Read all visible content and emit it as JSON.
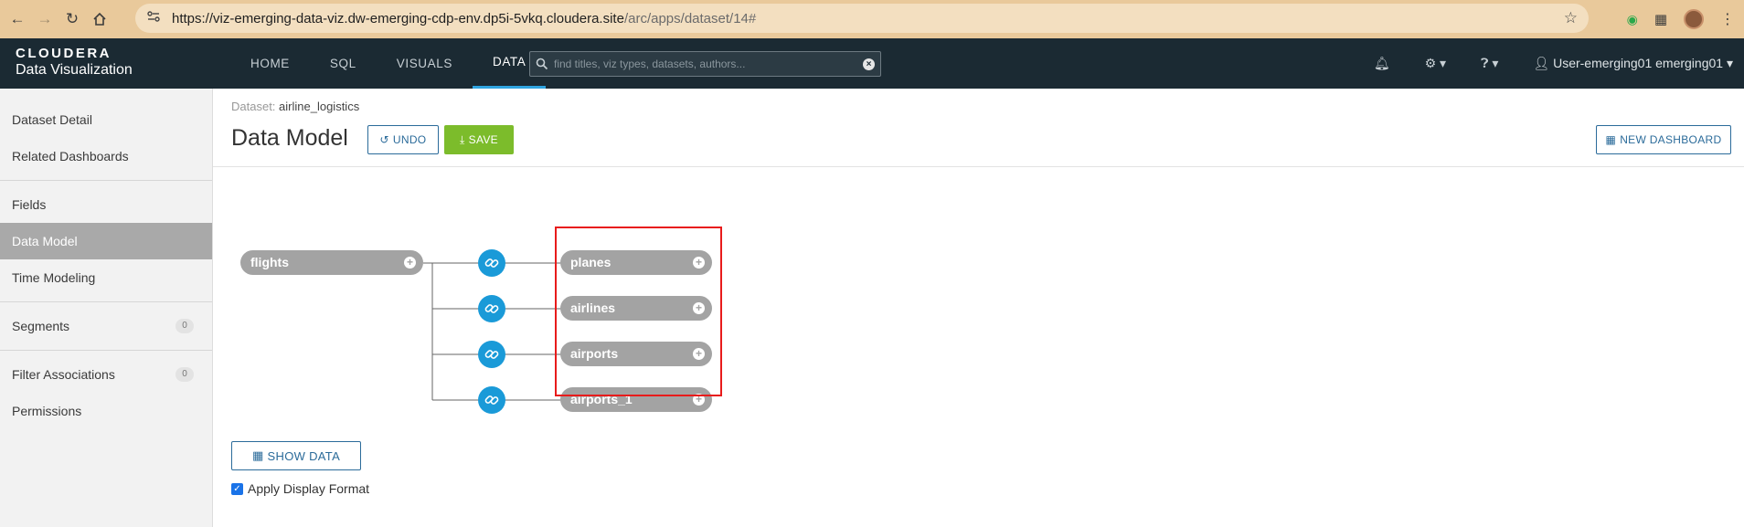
{
  "browser": {
    "url_host": "https://viz-emerging-data-viz.dw-emerging-cdp-env.dp5i-5vkq.cloudera.site",
    "url_path": "/arc/apps/dataset/14#"
  },
  "app": {
    "brand": "CLOUDERA",
    "product": "Data Visualization",
    "nav": [
      "HOME",
      "SQL",
      "VISUALS",
      "DATA"
    ],
    "active_nav": "DATA",
    "search_placeholder": "find titles, viz types, datasets, authors...",
    "user": "User-emerging01 emerging01"
  },
  "sidebar": {
    "items": [
      {
        "label": "Dataset Detail"
      },
      {
        "label": "Related Dashboards"
      },
      {
        "label": "Fields"
      },
      {
        "label": "Data Model"
      },
      {
        "label": "Time Modeling"
      },
      {
        "label": "Segments",
        "badge": "0"
      },
      {
        "label": "Filter Associations",
        "badge": "0"
      },
      {
        "label": "Permissions"
      }
    ],
    "active": "Data Model"
  },
  "main": {
    "dataset_prefix": "Dataset:",
    "dataset_name": "airline_logistics",
    "title": "Data Model",
    "undo_label": "UNDO",
    "save_label": "SAVE",
    "new_dashboard_label": "NEW DASHBOARD",
    "show_data_label": "SHOW DATA",
    "apply_display_format_label": "Apply Display Format",
    "apply_display_format_checked": true
  },
  "data_model": {
    "base_table": "flights",
    "joined_tables": [
      "planes",
      "airlines",
      "airports",
      "airports_1"
    ]
  },
  "colors": {
    "header_bg": "#1b2a33",
    "accent_blue": "#1a9ad8",
    "save_green": "#7cbc2b",
    "highlight_red": "#e81b1b",
    "browser_bar": "#e9c99b"
  }
}
